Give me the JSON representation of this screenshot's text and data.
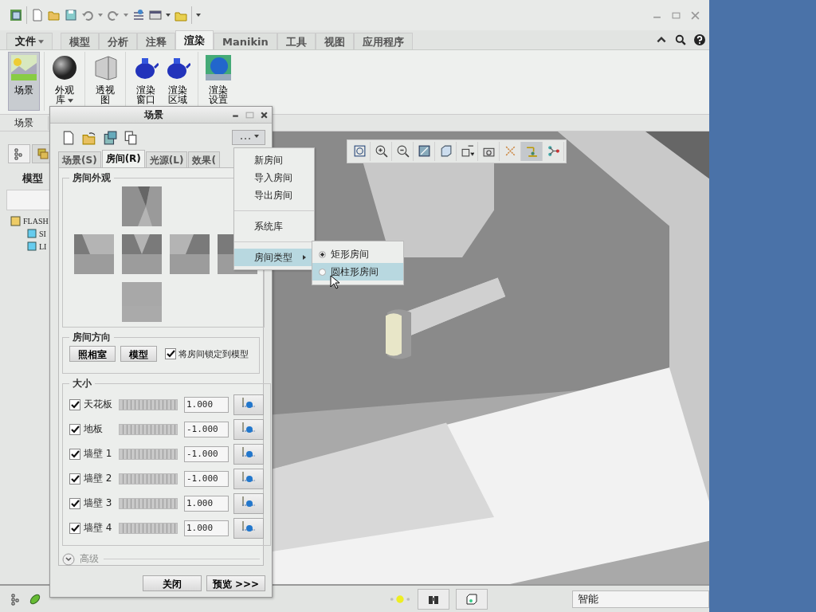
{
  "ribbon_tabs": [
    {
      "label": "文件",
      "kind": "menu",
      "selected": false
    },
    {
      "label": "模型",
      "kind": "tab",
      "selected": false
    },
    {
      "label": "分析",
      "kind": "tab",
      "selected": false
    },
    {
      "label": "注释",
      "kind": "tab",
      "selected": false
    },
    {
      "label": "渲染",
      "kind": "tab",
      "selected": true
    },
    {
      "label": "Manikin",
      "kind": "tab",
      "selected": false
    },
    {
      "label": "工具",
      "kind": "tab",
      "selected": false
    },
    {
      "label": "视图",
      "kind": "tab",
      "selected": false
    },
    {
      "label": "应用程序",
      "kind": "tab",
      "selected": false
    }
  ],
  "ribbon_buttons": [
    {
      "label": "场景",
      "selected": true,
      "dropdown": false
    },
    {
      "label": "外观库",
      "selected": false,
      "dropdown": true
    },
    {
      "label": "透视图",
      "selected": false,
      "dropdown": false
    },
    {
      "label": "渲染窗口",
      "selected": false,
      "dropdown": false
    },
    {
      "label": "渲染区域",
      "selected": false,
      "dropdown": false
    },
    {
      "label": "渲染设置",
      "selected": false,
      "dropdown": false
    }
  ],
  "ribbon_group": "场景",
  "model_tree": {
    "title": "模型",
    "items": [
      {
        "label": "FLASH",
        "children": [
          {
            "label": "SI"
          },
          {
            "label": "LI"
          }
        ]
      }
    ]
  },
  "view_toolbar": [
    {
      "selected": false
    },
    {
      "selected": false
    },
    {
      "selected": false
    },
    {
      "selected": false
    },
    {
      "selected": false
    },
    {
      "selected": false
    },
    {
      "selected": false
    },
    {
      "selected": false
    },
    {
      "selected": true
    },
    {
      "selected": false
    }
  ],
  "status_bar": {
    "filter": "智能"
  },
  "dialog": {
    "title": "场景",
    "tabs": [
      {
        "label": "场景(S)",
        "selected": false
      },
      {
        "label": "房间(R)",
        "selected": true
      },
      {
        "label": "光源(L)",
        "selected": false
      },
      {
        "label": "效果(",
        "selected": false
      }
    ],
    "appearance": {
      "title": "房间外观"
    },
    "orientation": {
      "title": "房间方向",
      "buttons": [
        "照相室",
        "模型"
      ],
      "lock": {
        "label": "将房间锁定到模型",
        "checked": true
      }
    },
    "size": {
      "title": "大小",
      "rows": [
        {
          "label": "天花板",
          "checked": true,
          "value": "1.000"
        },
        {
          "label": "地板",
          "checked": true,
          "value": "-1.000"
        },
        {
          "label": "墙壁 1",
          "checked": true,
          "value": "-1.000"
        },
        {
          "label": "墙壁 2",
          "checked": true,
          "value": "-1.000"
        },
        {
          "label": "墙壁 3",
          "checked": true,
          "value": "1.000"
        },
        {
          "label": "墙壁 4",
          "checked": true,
          "value": "1.000"
        }
      ]
    },
    "advanced": {
      "label": "高级",
      "disabled": true
    },
    "buttons": [
      "关闭",
      "预览 >>>"
    ]
  },
  "context_menu": {
    "items": [
      {
        "kind": "item",
        "label": "新房间",
        "selected": false
      },
      {
        "kind": "item",
        "label": "导入房间",
        "selected": false
      },
      {
        "kind": "item",
        "label": "导出房间",
        "selected": false
      },
      {
        "kind": "separator"
      },
      {
        "kind": "item",
        "label": "系统库",
        "selected": false
      },
      {
        "kind": "separator"
      },
      {
        "kind": "submenu",
        "label": "房间类型",
        "selected": true
      }
    ]
  },
  "submenu": {
    "items": [
      {
        "label": "矩形房间",
        "checked": true,
        "selected": false
      },
      {
        "label": "圆柱形房间",
        "checked": false,
        "selected": true
      }
    ]
  }
}
